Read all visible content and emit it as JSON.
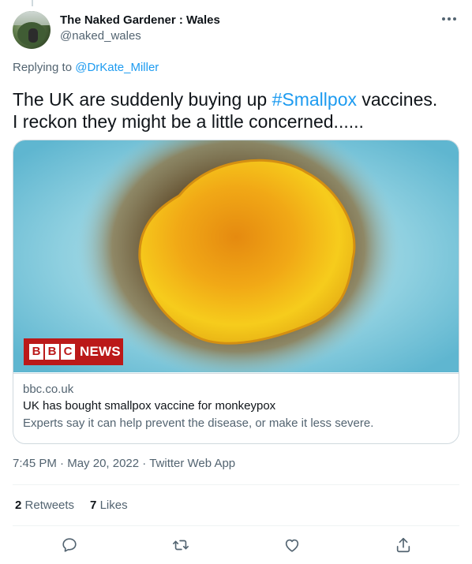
{
  "user": {
    "display_name": "The Naked Gardener : Wales",
    "handle": "@naked_wales"
  },
  "reply": {
    "prefix": "Replying to ",
    "to": "@DrKate_Miller"
  },
  "tweet": {
    "line1_before": "The UK are suddenly buying up ",
    "hashtag": "#Smallpox",
    "line1_after": " vaccines.",
    "line2": "I reckon they might be a little concerned......"
  },
  "card": {
    "logo_letters": [
      "B",
      "B",
      "C"
    ],
    "logo_word": "NEWS",
    "domain": "bbc.co.uk",
    "title": "UK has bought smallpox vaccine for monkeypox",
    "description": "Experts say it can help prevent the disease, or make it less severe."
  },
  "meta": {
    "time": "7:45 PM",
    "sep1": " · ",
    "date": "May 20, 2022",
    "sep2": " · ",
    "source": "Twitter Web App"
  },
  "stats": {
    "retweets_count": "2",
    "retweets_label": "Retweets",
    "likes_count": "7",
    "likes_label": "Likes"
  },
  "icons": {
    "reply": "reply-icon",
    "retweet": "retweet-icon",
    "like": "heart-icon",
    "share": "share-icon",
    "more": "more-icon"
  },
  "colors": {
    "accent": "#1d9bf0",
    "secondary_text": "#536471",
    "bbc_red": "#bb1919"
  }
}
